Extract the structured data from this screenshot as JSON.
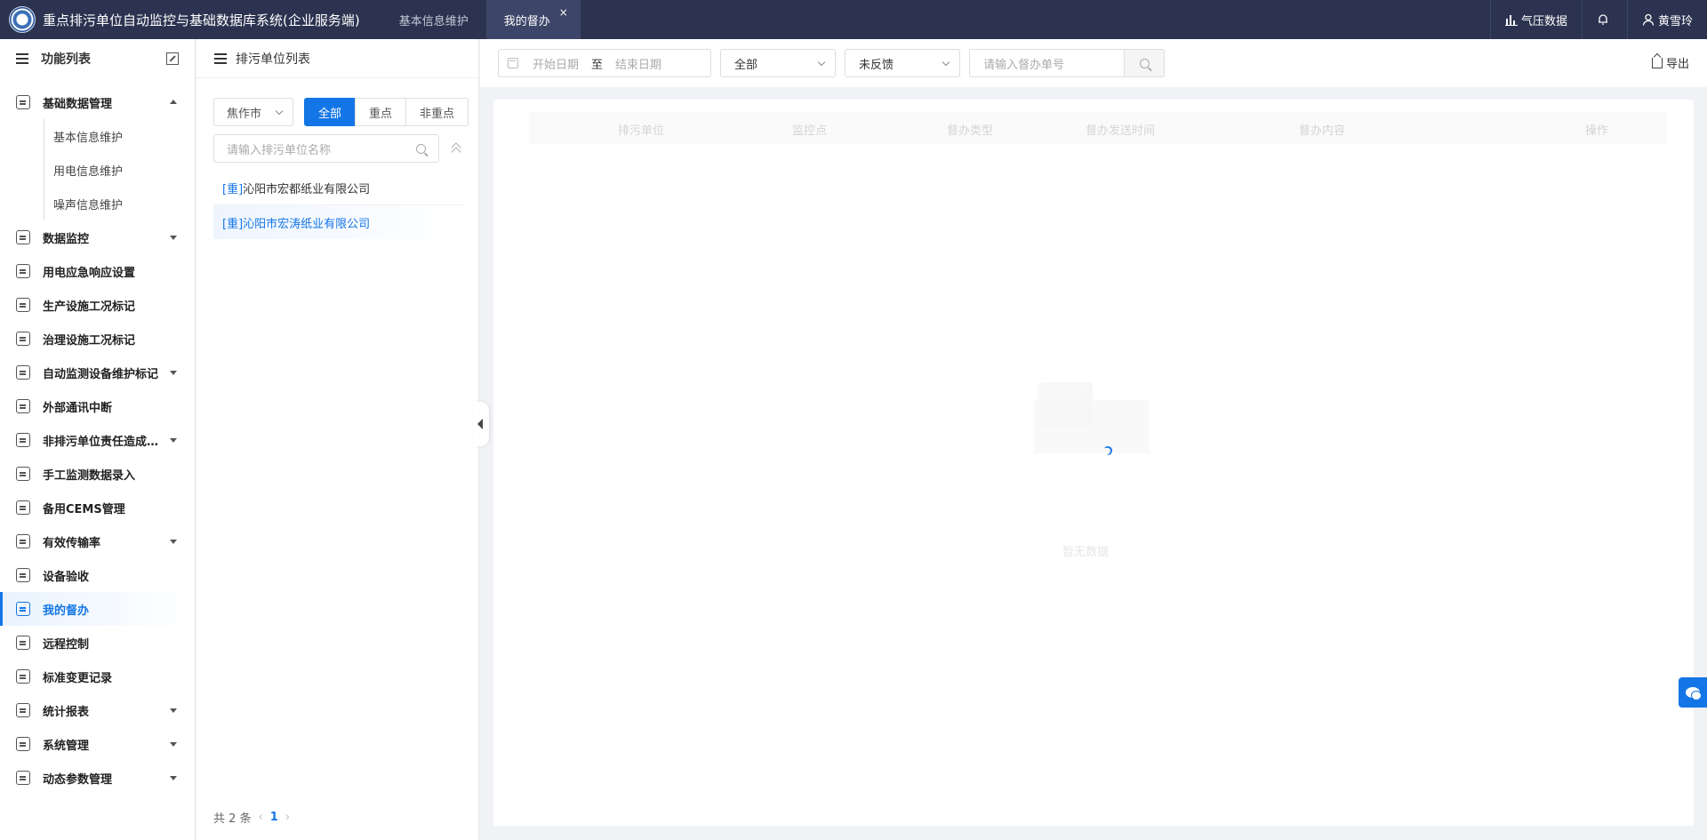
{
  "header": {
    "app_title": "重点排污单位自动监控与基础数据库系统(企业服务端)",
    "tabs": [
      {
        "label": "基本信息维护"
      },
      {
        "label": "我的督办"
      }
    ],
    "tab_close": "×",
    "pressure_data": "气压数据",
    "user_name": "黄雪玲"
  },
  "sidebar": {
    "title": "功能列表",
    "items": [
      {
        "label": "基础数据管理"
      },
      {
        "label": "数据监控"
      },
      {
        "label": "用电应急响应设置"
      },
      {
        "label": "生产设施工况标记"
      },
      {
        "label": "治理设施工况标记"
      },
      {
        "label": "自动监测设备维护标记"
      },
      {
        "label": "外部通讯中断"
      },
      {
        "label": "非排污单位责任造成…"
      },
      {
        "label": "手工监测数据录入"
      },
      {
        "label": "备用CEMS管理"
      },
      {
        "label": "有效传输率"
      },
      {
        "label": "设备验收"
      },
      {
        "label": "我的督办"
      },
      {
        "label": "远程控制"
      },
      {
        "label": "标准变更记录"
      },
      {
        "label": "统计报表"
      },
      {
        "label": "系统管理"
      },
      {
        "label": "动态参数管理"
      }
    ],
    "sub_items": [
      {
        "label": "基本信息维护"
      },
      {
        "label": "用电信息维护"
      },
      {
        "label": "噪声信息维护"
      }
    ]
  },
  "unit_panel": {
    "title": "排污单位列表",
    "city": "焦作市",
    "filters": [
      "全部",
      "重点",
      "非重点"
    ],
    "search_placeholder": "请输入排污单位名称",
    "units": [
      {
        "tag": "[重]",
        "name": "沁阳市宏都纸业有限公司"
      },
      {
        "tag": "[重]",
        "name": "沁阳市宏涛纸业有限公司"
      }
    ],
    "total": "共 2 条",
    "prev": "‹",
    "page": "1",
    "next": "›"
  },
  "toolbar": {
    "start_date_placeholder": "开始日期",
    "date_sep": "至",
    "end_date_placeholder": "结束日期",
    "type_select": "全部",
    "feedback_select": "未反馈",
    "order_placeholder": "请输入督办单号",
    "export_label": "导出"
  },
  "table": {
    "columns": [
      "排污单位",
      "监控点",
      "督办类型",
      "督办发送时间",
      "督办内容",
      "操作"
    ],
    "empty_text": "暂无数据"
  }
}
